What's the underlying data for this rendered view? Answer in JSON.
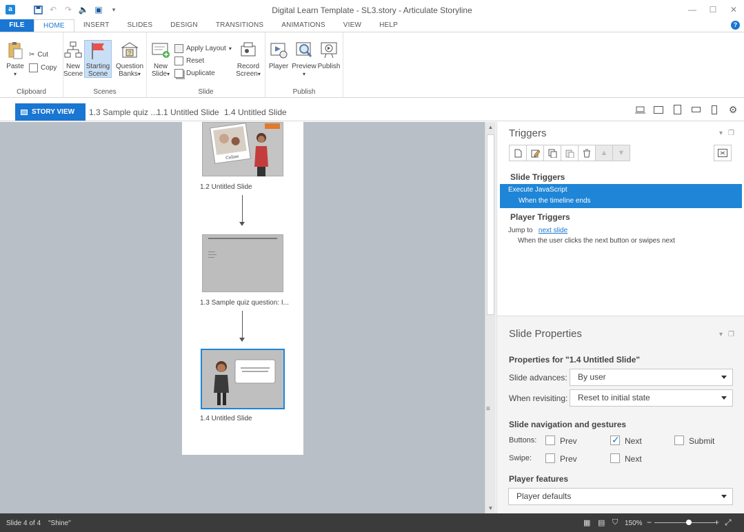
{
  "window": {
    "title": "Digital Learn Template - SL3.story - Articulate Storyline",
    "app_icon": "storyline-app-icon"
  },
  "ribbon_tabs": [
    "FILE",
    "HOME",
    "INSERT",
    "SLIDES",
    "DESIGN",
    "TRANSITIONS",
    "ANIMATIONS",
    "VIEW",
    "HELP"
  ],
  "ribbon": {
    "clipboard": {
      "label": "Clipboard",
      "paste": "Paste",
      "cut": "Cut",
      "copy": "Copy"
    },
    "scenes": {
      "label": "Scenes",
      "new_scene_1": "New",
      "new_scene_2": "Scene",
      "starting_scene_1": "Starting",
      "starting_scene_2": "Scene",
      "question_banks_1": "Question",
      "question_banks_2": "Banks"
    },
    "slide": {
      "label": "Slide",
      "new_slide_1": "New",
      "new_slide_2": "Slide",
      "apply_layout": "Apply Layout",
      "reset": "Reset",
      "duplicate": "Duplicate",
      "record_1": "Record",
      "record_2": "Screen"
    },
    "publish": {
      "label": "Publish",
      "player": "Player",
      "preview": "Preview",
      "publish": "Publish"
    }
  },
  "tabstrip": {
    "story_view": "STORY VIEW",
    "tabs": [
      "1.3 Sample quiz ...",
      "1.1 Untitled Slide",
      "1.4 Untitled Slide"
    ]
  },
  "scene": {
    "slides": [
      {
        "label": "1.2 Untitled Slide"
      },
      {
        "label": "1.3 Sample quiz question: I..."
      },
      {
        "label": "1.4 Untitled Slide"
      }
    ]
  },
  "triggers": {
    "title": "Triggers",
    "slide_triggers_title": "Slide Triggers",
    "selected_action": "Execute JavaScript",
    "selected_condition": "When the timeline ends",
    "player_triggers_title": "Player Triggers",
    "jump_to": "Jump to",
    "jump_target": "next slide",
    "jump_condition": "When the user clicks the next button or swipes next"
  },
  "slide_properties": {
    "title": "Slide Properties",
    "properties_for": "Properties for \"1.4 Untitled Slide\"",
    "slide_advances_label": "Slide advances:",
    "slide_advances_value": "By user",
    "when_revisiting_label": "When revisiting:",
    "when_revisiting_value": "Reset to initial state",
    "nav_title": "Slide navigation and gestures",
    "buttons_label": "Buttons:",
    "swipe_label": "Swipe:",
    "prev": "Prev",
    "next": "Next",
    "submit": "Submit",
    "player_features_title": "Player features",
    "player_features_value": "Player defaults"
  },
  "status": {
    "slide_count": "Slide 4 of 4",
    "theme": "\"Shine\"",
    "zoom": "150%"
  }
}
